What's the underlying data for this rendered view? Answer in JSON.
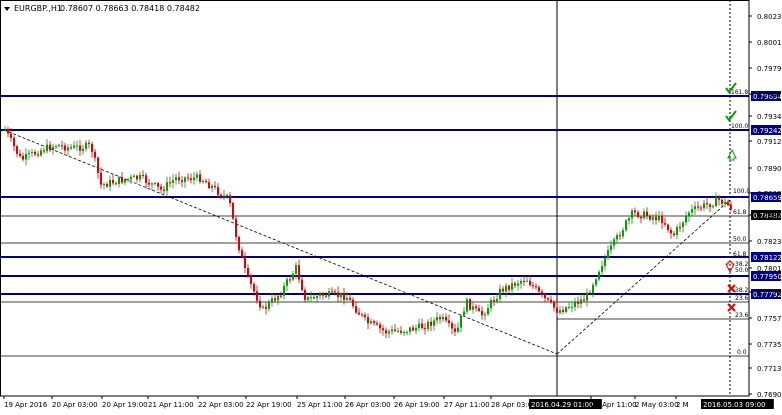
{
  "header": {
    "symbol": "EURGBP.,H1",
    "ohlc": "0.78607 0.78663 0.78418 0.78482",
    "menu_icon": "triangle-down-icon"
  },
  "colors": {
    "bull": "#00a000",
    "bear": "#e00000",
    "level_line": "#000080",
    "price_tag_bg": "#000080",
    "current_price_bg": "#000000",
    "check": "#00a000",
    "cross": "#e00000",
    "grid": "#000000"
  },
  "chart_data": {
    "type": "candlestick",
    "symbol": "EURGBP.",
    "timeframe": "H1",
    "ylim": [
      0.769,
      0.785
    ],
    "y_ticks": [
      "0.80235",
      "0.80015",
      "0.79795",
      "0.79575",
      "0.79345",
      "0.79125",
      "0.78905",
      "0.78685",
      "0.78465",
      "0.78235",
      "0.78015",
      "0.77795",
      "0.77575",
      "0.77350",
      "0.77130",
      "0.76905"
    ],
    "x_ticks": [
      "19 Apr 2016",
      "20 Apr 03:00",
      "20 Apr 19:00",
      "21 Apr 11:00",
      "22 Apr 03:00",
      "22 Apr 19:00",
      "25 Apr 11:00",
      "26 Apr 03:00",
      "26 Apr 19:00",
      "27 Apr 11:00",
      "28 Apr 03:00",
      "2016.04.29 01:00",
      "29 Apr 11:00",
      "2 May 03:00",
      "2 M",
      "2016.05.03 09:00"
    ],
    "price_tags": [
      "0.79634",
      "0.79242",
      "0.78659",
      "0.78482",
      "0.78122",
      "0.77950",
      "0.77792"
    ],
    "current_price": "0.78482",
    "fib_labels": [
      "161.8",
      "100.0",
      "100.0",
      "61.8",
      "50.0",
      "61.8",
      "38.2",
      "50.0",
      "38.2",
      "23.6",
      "23.6",
      "0.0"
    ],
    "crosshair_time": "2016.04.29 01:00",
    "last_time": "2016.05.03 09:00",
    "trendline": {
      "from": "19 Apr 2016",
      "to": "2016.04.29 01:00"
    }
  }
}
